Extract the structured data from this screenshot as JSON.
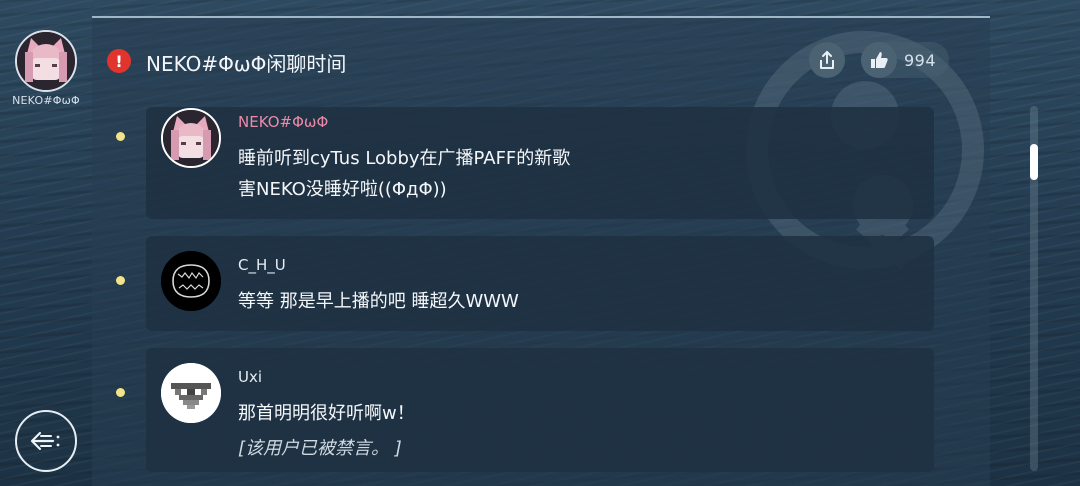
{
  "profile": {
    "name": "NEKO#ΦωΦ"
  },
  "thread": {
    "title": "NEKO#ΦωΦ闲聊时间",
    "like_count": "994"
  },
  "comments": [
    {
      "user": "NEKO#ΦωΦ",
      "lines": [
        "睡前听到cyTus Lobby在广播PAFF的新歌",
        "害NEKO没睡好啦((ΦдΦ))"
      ]
    },
    {
      "user": "C_H_U",
      "lines": [
        "等等 那是早上播的吧 睡超久WWW"
      ]
    },
    {
      "user": "Uxi",
      "lines": [
        "那首明明很好听啊w！"
      ],
      "muted_note": "[该用户已被禁言。 ]"
    }
  ],
  "colors": {
    "accent_pink": "#e98aa8",
    "bullet": "#f1e48a",
    "alert": "#e0342c"
  },
  "icons": {
    "alert": "alert-icon",
    "share": "share-icon",
    "like": "thumbs-up-icon",
    "back": "back-arrow-icon"
  }
}
